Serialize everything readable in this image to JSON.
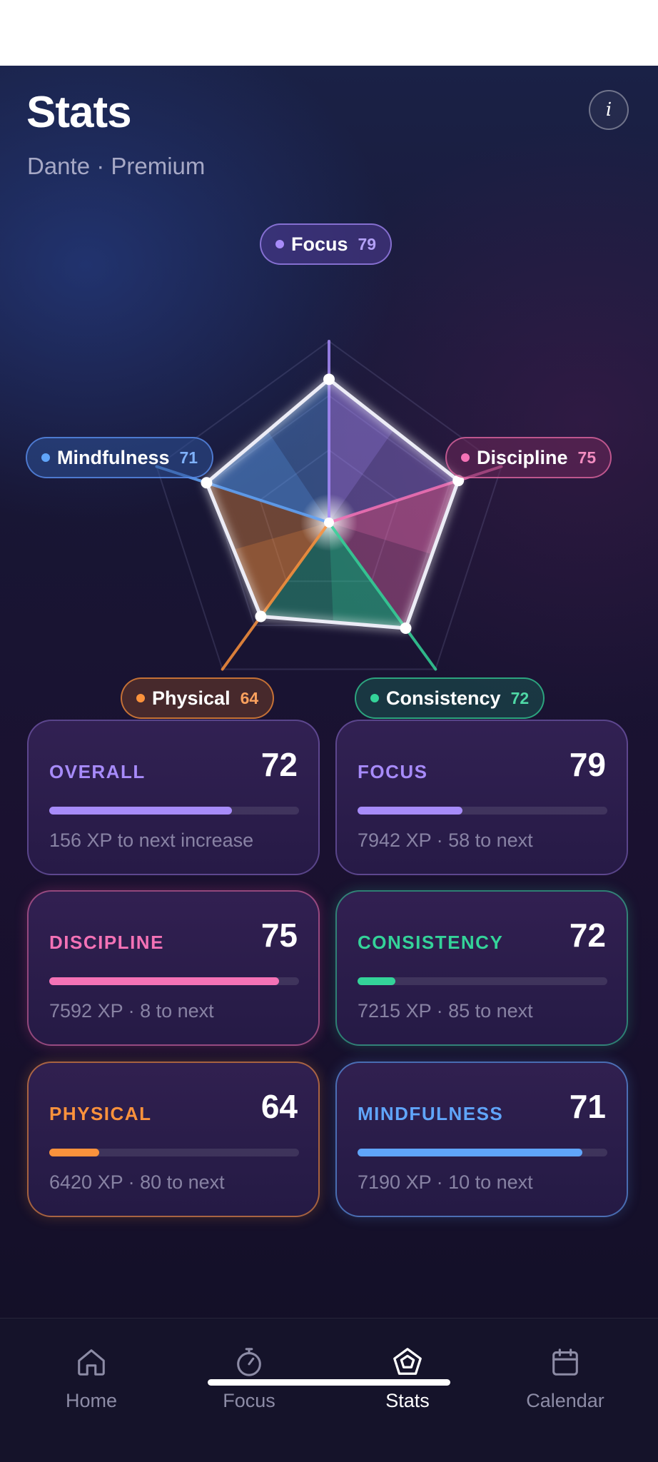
{
  "header": {
    "title": "Stats",
    "subtitle": "Dante · Premium",
    "info_label": "i"
  },
  "radar": {
    "axes": [
      {
        "key": "focus",
        "label": "Focus",
        "value": 79,
        "color": "#a78bfa"
      },
      {
        "key": "discipline",
        "label": "Discipline",
        "value": 75,
        "color": "#f472b6"
      },
      {
        "key": "consistency",
        "label": "Consistency",
        "value": 72,
        "color": "#34d399"
      },
      {
        "key": "physical",
        "label": "Physical",
        "value": 64,
        "color": "#fb923c"
      },
      {
        "key": "mindfulness",
        "label": "Mindfulness",
        "value": 71,
        "color": "#60a5fa"
      }
    ],
    "max": 100
  },
  "cards": {
    "overall": {
      "label": "OVERALL",
      "value": "72",
      "progress": 0.73,
      "sub": "156 XP to next increase"
    },
    "focus": {
      "label": "FOCUS",
      "value": "79",
      "progress": 0.42,
      "sub": "7942 XP · 58 to next"
    },
    "discipline": {
      "label": "DISCIPLINE",
      "value": "75",
      "progress": 0.92,
      "sub": "7592 XP · 8 to next"
    },
    "consistency": {
      "label": "CONSISTENCY",
      "value": "72",
      "progress": 0.15,
      "sub": "7215 XP · 85 to next"
    },
    "physical": {
      "label": "PHYSICAL",
      "value": "64",
      "progress": 0.2,
      "sub": "6420 XP · 80 to next"
    },
    "mindfulness": {
      "label": "MINDFULNESS",
      "value": "71",
      "progress": 0.9,
      "sub": "7190 XP · 10 to next"
    }
  },
  "tabs": [
    {
      "label": "Home",
      "icon": "home-icon"
    },
    {
      "label": "Focus",
      "icon": "timer-icon"
    },
    {
      "label": "Stats",
      "icon": "pentagon-icon",
      "active": true
    },
    {
      "label": "Calendar",
      "icon": "calendar-icon"
    }
  ]
}
